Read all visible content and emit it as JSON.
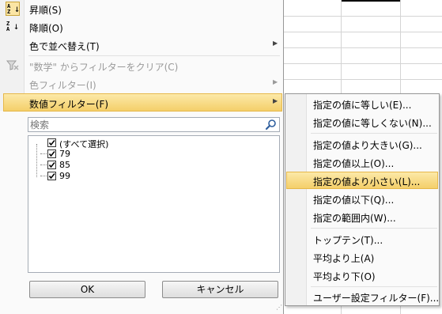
{
  "menu": {
    "sort_asc": "昇順(S)",
    "sort_desc": "降順(O)",
    "sort_by_color": "色で並べ替え(T)",
    "clear_filter": "\"数学\" からフィルターをクリア(C)",
    "color_filter": "色フィルター(I)",
    "number_filter": "数値フィルター(F)",
    "sort_asc_icon_top": "A",
    "sort_asc_icon_bottom": "Z",
    "sort_desc_icon_top": "Z",
    "sort_desc_icon_bottom": "A"
  },
  "search": {
    "placeholder": "検索"
  },
  "values": [
    {
      "label": "(すべて選択)",
      "checked": true
    },
    {
      "label": "79",
      "checked": true
    },
    {
      "label": "85",
      "checked": true
    },
    {
      "label": "99",
      "checked": true
    }
  ],
  "buttons": {
    "ok": "OK",
    "cancel": "キャンセル"
  },
  "submenu": {
    "equals": "指定の値に等しい(E)...",
    "not_equals": "指定の値に等しくない(N)...",
    "greater_than": "指定の値より大きい(G)...",
    "greater_or_equal": "指定の値以上(O)...",
    "less_than": "指定の値より小さい(L)...",
    "less_or_equal": "指定の値以下(Q)...",
    "between": "指定の範囲内(W)...",
    "top_ten": "トップテン(T)...",
    "above_average": "平均より上(A)",
    "below_average": "平均より下(O)",
    "custom_filter": "ユーザー設定フィルター(F)..."
  },
  "colors": {
    "highlight": "#f4cf6a",
    "menu_bg": "#fafafa",
    "border": "#979797"
  }
}
